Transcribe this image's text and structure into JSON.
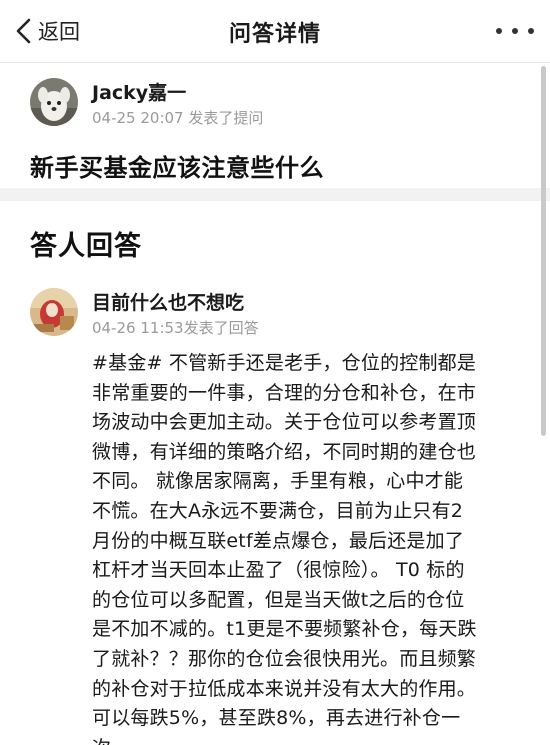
{
  "nav": {
    "back_label": "返回",
    "title": "问答详情",
    "back_icon": "chevron-left-icon",
    "more_icon": "more-horizontal-icon"
  },
  "question": {
    "asker_name": "Jacky嘉一",
    "meta": "04-25 20:07 发表了提问",
    "title": "新手买基金应该注意些什么"
  },
  "answers": {
    "heading": "答人回答",
    "items": [
      {
        "author": "目前什么也不想吃",
        "meta": "04-26 11:53发表了回答",
        "lines": [
          "#基金# 不管新手还是老手，仓位的控制都是",
          "非常重要的一件事，合理的分仓和补仓，在市",
          "场波动中会更加主动。关于仓位可以参考置顶",
          "微博，有详细的策略介绍，不同时期的建仓也",
          "不同。 就像居家隔离，手里有粮，心中才能",
          "不慌。在大A永远不要满仓，目前为止只有2",
          "月份的中概互联etf差点爆仓，最后还是加了",
          "杠杆才当天回本止盈了（很惊险）。 T0 标的",
          "的仓位可以多配置，但是当天做t之后的仓位",
          "是不加不减的。t1更是不要频繁补仓，每天跌",
          "了就补？？那你的仓位会很快用光。而且频繁",
          "的补仓对于拉低成本来说并没有太大的作用。",
          "可以每跌5%，甚至跌8%，再去进行补仓一",
          "次。"
        ]
      }
    ]
  },
  "colors": {
    "text": "#1a1a1a",
    "meta": "#9a9a9a",
    "divider": "#f2f2f2"
  }
}
